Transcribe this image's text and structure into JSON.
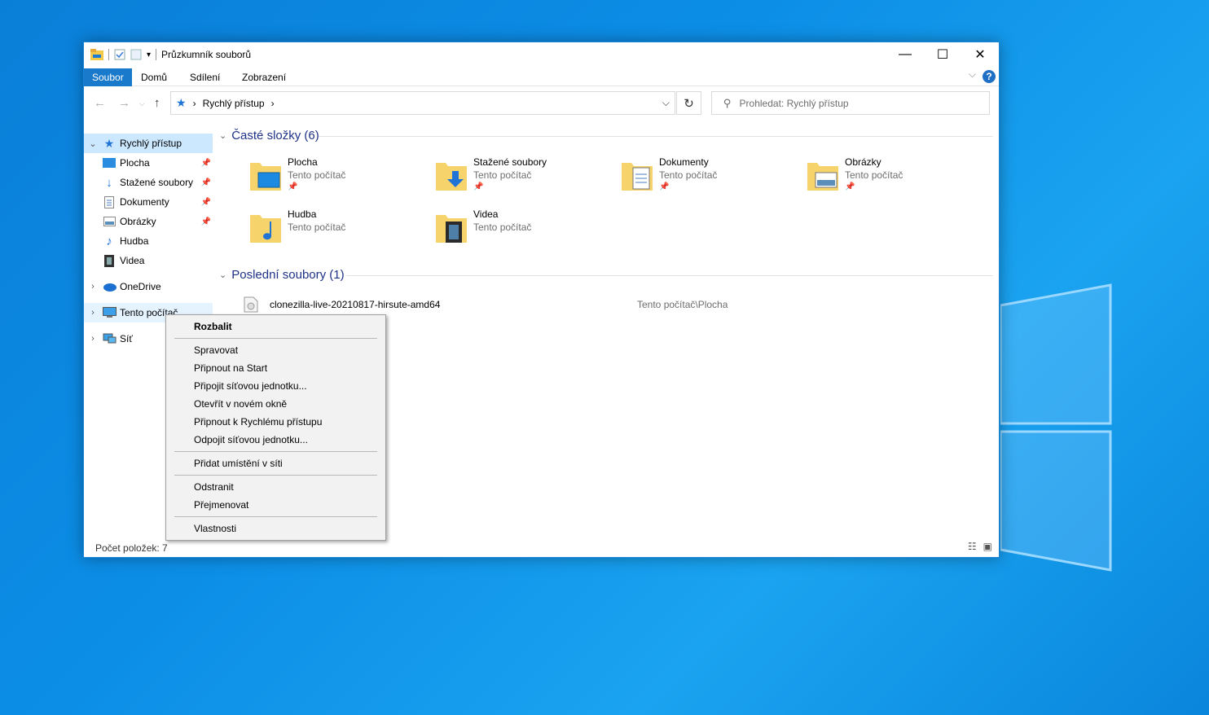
{
  "window": {
    "title": "Průzkumník souborů",
    "controls": {
      "minimize": "—",
      "maximize": "☐",
      "close": "✕"
    }
  },
  "ribbon": {
    "tabs": [
      "Soubor",
      "Domů",
      "Sdílení",
      "Zobrazení"
    ],
    "active_tab": "Soubor",
    "help": "?"
  },
  "address_bar": {
    "path": [
      "Rychlý přístup"
    ],
    "separator": "›"
  },
  "search": {
    "placeholder": "Prohledat: Rychlý přístup"
  },
  "sidebar": {
    "items": [
      {
        "label": "Rychlý přístup",
        "icon": "star-icon",
        "selected": true
      },
      {
        "label": "Plocha",
        "icon": "desktop-icon",
        "pinned": true
      },
      {
        "label": "Stažené soubory",
        "icon": "download-icon",
        "pinned": true
      },
      {
        "label": "Dokumenty",
        "icon": "document-icon",
        "pinned": true
      },
      {
        "label": "Obrázky",
        "icon": "picture-icon",
        "pinned": true
      },
      {
        "label": "Hudba",
        "icon": "music-icon"
      },
      {
        "label": "Videa",
        "icon": "video-icon"
      },
      {
        "label": "OneDrive",
        "icon": "cloud-icon"
      },
      {
        "label": "Tento počítač",
        "icon": "computer-icon"
      },
      {
        "label": "Síť",
        "icon": "network-icon"
      }
    ]
  },
  "frequent": {
    "header": "Časté složky (6)",
    "folders": [
      {
        "name": "Plocha",
        "location": "Tento počítač",
        "pinned": true
      },
      {
        "name": "Stažené soubory",
        "location": "Tento počítač",
        "pinned": true
      },
      {
        "name": "Dokumenty",
        "location": "Tento počítač",
        "pinned": true
      },
      {
        "name": "Obrázky",
        "location": "Tento počítač",
        "pinned": true
      },
      {
        "name": "Hudba",
        "location": "Tento počítač"
      },
      {
        "name": "Videa",
        "location": "Tento počítač"
      }
    ]
  },
  "recent": {
    "header": "Poslední soubory (1)",
    "files": [
      {
        "name": "clonezilla-live-20210817-hirsute-amd64",
        "path": "Tento počítač\\Plocha"
      }
    ]
  },
  "status_bar": {
    "count": "Počet položek: 7"
  },
  "context_menu": {
    "items": [
      "Rozbalit",
      "Spravovat",
      "Připnout na Start",
      "Připojit síťovou jednotku...",
      "Otevřít v novém okně",
      "Připnout k Rychlému přístupu",
      "Odpojit síťovou jednotku...",
      "Přidat umístění v síti",
      "Odstranit",
      "Přejmenovat",
      "Vlastnosti"
    ]
  },
  "colors": {
    "accent": "#1979ca",
    "selection": "#cce8ff",
    "header_text": "#1e3287",
    "folder": "#f7d36b"
  }
}
